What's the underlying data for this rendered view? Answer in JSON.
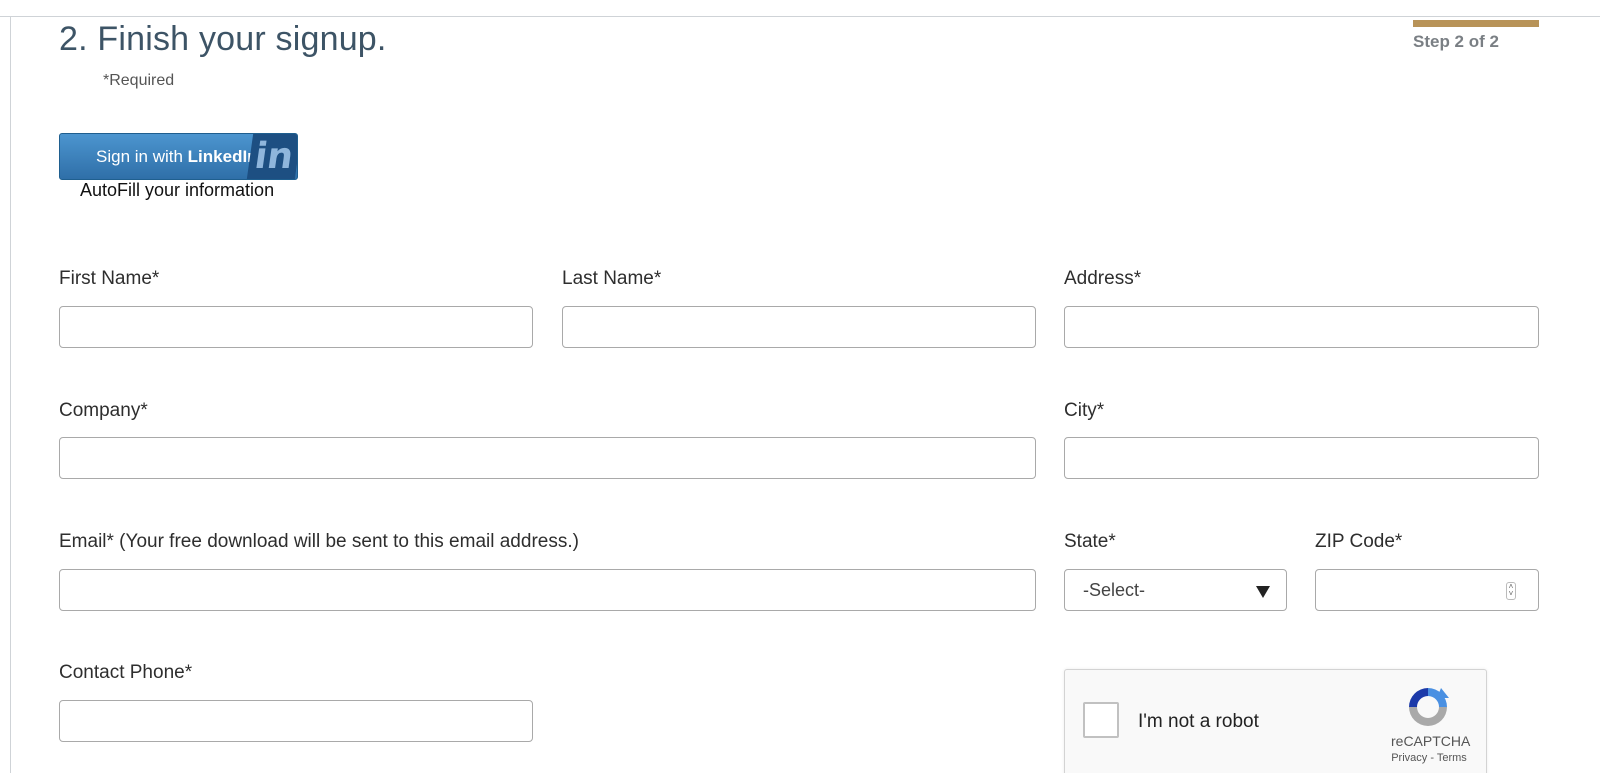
{
  "header": {
    "title": "2. Finish your signup.",
    "required_note": "*Required",
    "step_label": "Step 2 of 2",
    "step_bar_color": "#b89358"
  },
  "linkedin": {
    "button_prefix": "Sign in with ",
    "button_brand": "LinkedIn",
    "logo_text": "in",
    "autofill_text": "AutoFill your information",
    "brand_color": "#2f6fa8"
  },
  "form": {
    "first_name": {
      "label": "First Name*",
      "value": ""
    },
    "last_name": {
      "label": "Last Name*",
      "value": ""
    },
    "address": {
      "label": "Address*",
      "value": ""
    },
    "company": {
      "label": "Company*",
      "value": ""
    },
    "city": {
      "label": "City*",
      "value": ""
    },
    "email": {
      "label": "Email* (Your free download will be sent to this email address.)",
      "value": ""
    },
    "state": {
      "label": "State*",
      "selected": "-Select-"
    },
    "zip": {
      "label": "ZIP Code*",
      "value": ""
    },
    "phone": {
      "label": "Contact Phone*",
      "value": ""
    }
  },
  "captcha": {
    "label": "I'm not a robot",
    "brand": "reCAPTCHA",
    "privacy": "Privacy",
    "separator": " - ",
    "terms": "Terms",
    "logo_icon": "recaptcha-icon"
  }
}
